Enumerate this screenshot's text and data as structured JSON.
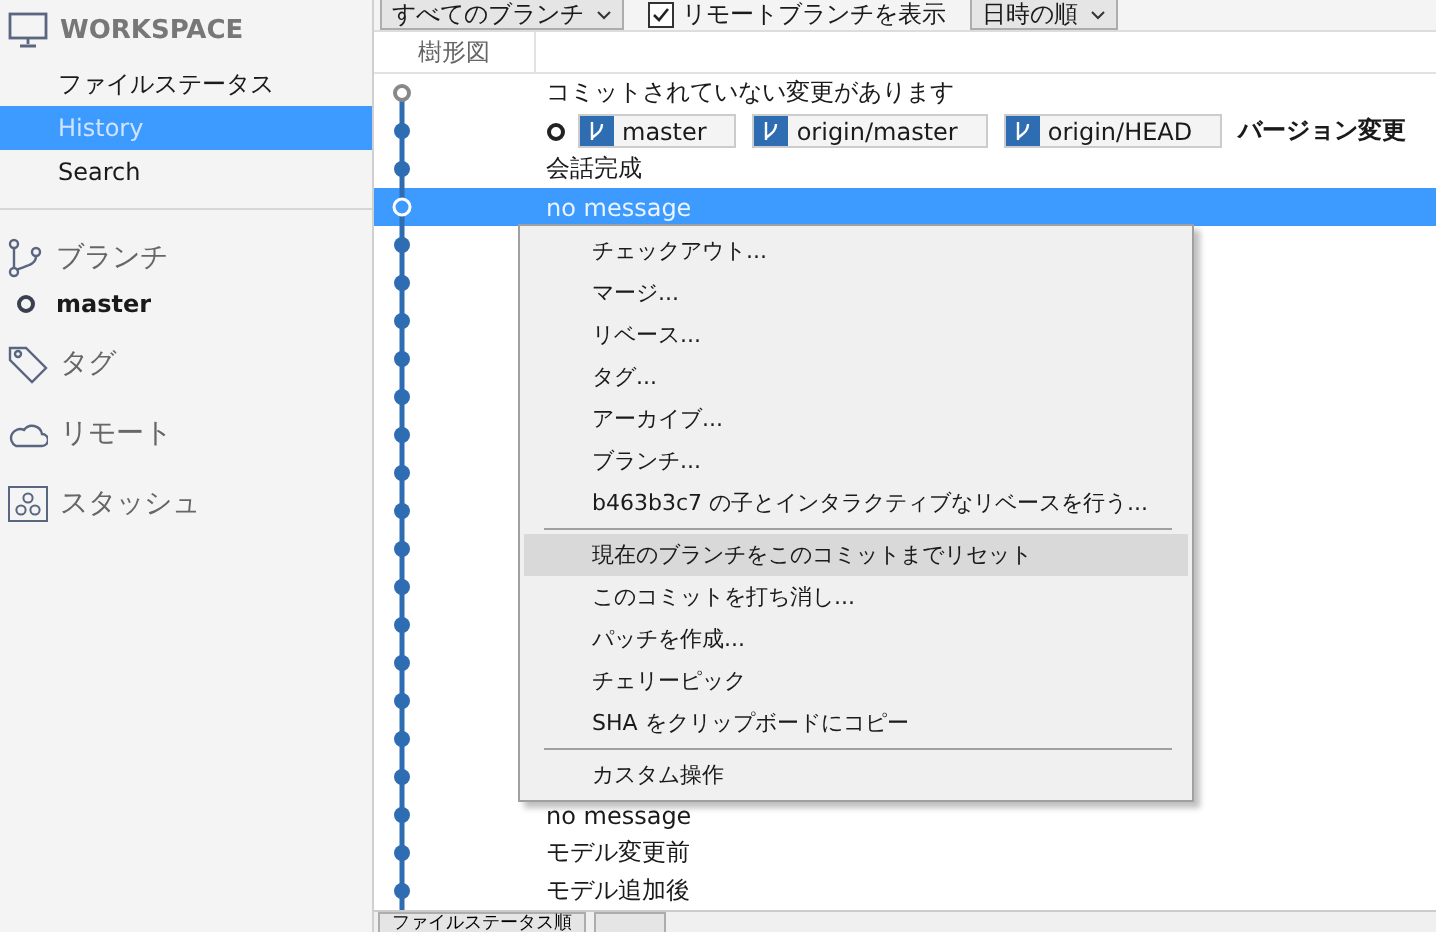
{
  "sidebar": {
    "workspace": {
      "title": "WORKSPACE",
      "items": [
        {
          "label": "ファイルステータス",
          "selected": false
        },
        {
          "label": "History",
          "selected": true
        },
        {
          "label": "Search",
          "selected": false
        }
      ]
    },
    "sections": [
      {
        "kind": "branches",
        "label": "ブランチ",
        "children": [
          {
            "label": "master",
            "current": true
          }
        ]
      },
      {
        "kind": "tags",
        "label": "タグ"
      },
      {
        "kind": "remotes",
        "label": "リモート"
      },
      {
        "kind": "stashes",
        "label": "スタッシュ"
      }
    ]
  },
  "toolbar": {
    "branch_filter": "すべてのブランチ",
    "show_remote": {
      "label": "リモートブランチを表示",
      "checked": true
    },
    "sort": "日時の順"
  },
  "history": {
    "columns": [
      "樹形図"
    ],
    "rows": [
      {
        "kind": "uncommitted",
        "message": "コミットされていない変更があります",
        "selected": false
      },
      {
        "kind": "commit",
        "head": true,
        "refs": [
          "master",
          "origin/master",
          "origin/HEAD"
        ],
        "message": "バージョン変更",
        "selected": false
      },
      {
        "kind": "commit",
        "message": "会話完成",
        "selected": false
      },
      {
        "kind": "commit",
        "message": "no message",
        "selected": true
      }
    ],
    "rows_after_menu": [
      {
        "kind": "commit",
        "message": "no message",
        "selected": false
      },
      {
        "kind": "commit",
        "message": "モデル変更前",
        "selected": false
      },
      {
        "kind": "commit",
        "message": "モデル追加後",
        "selected": false
      }
    ]
  },
  "context_menu": [
    {
      "kind": "item",
      "label": "チェックアウト...",
      "selected": false
    },
    {
      "kind": "item",
      "label": "マージ...",
      "selected": false
    },
    {
      "kind": "item",
      "label": "リベース...",
      "selected": false
    },
    {
      "kind": "item",
      "label": "タグ...",
      "selected": false
    },
    {
      "kind": "item",
      "label": "アーカイブ...",
      "selected": false
    },
    {
      "kind": "item",
      "label": "ブランチ...",
      "selected": false
    },
    {
      "kind": "item",
      "label": "b463b3c7 の子とインタラクティブなリベースを行う...",
      "selected": false
    },
    {
      "kind": "separator"
    },
    {
      "kind": "item",
      "label": "現在のブランチをこのコミットまでリセット",
      "selected": true
    },
    {
      "kind": "item",
      "label": "このコミットを打ち消し...",
      "selected": false
    },
    {
      "kind": "item",
      "label": "パッチを作成...",
      "selected": false
    },
    {
      "kind": "item",
      "label": "チェリーピック",
      "selected": false
    },
    {
      "kind": "item",
      "label": "SHA をクリップボードにコピー",
      "selected": false
    },
    {
      "kind": "separator"
    },
    {
      "kind": "item",
      "label": "カスタム操作",
      "selected": false
    }
  ],
  "bottom_bar": {
    "sort_button": "ファイルステータス順"
  }
}
